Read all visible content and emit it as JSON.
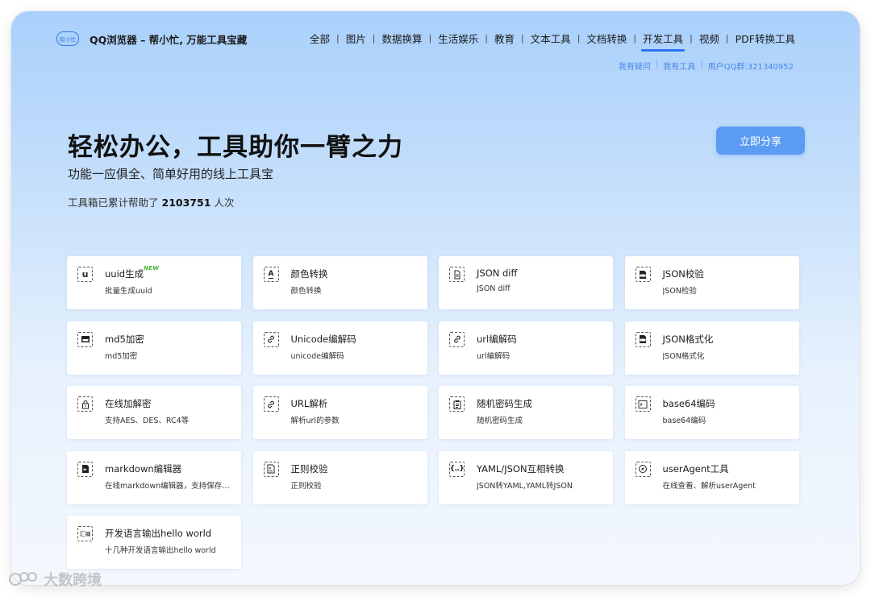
{
  "header": {
    "logo_text": "帮小忙",
    "site_title": "QQ浏览器 – 帮小忙, 万能工具宝藏",
    "nav": [
      {
        "label": "全部",
        "active": false
      },
      {
        "label": "图片",
        "active": false
      },
      {
        "label": "数据换算",
        "active": false
      },
      {
        "label": "生活娱乐",
        "active": false
      },
      {
        "label": "教育",
        "active": false
      },
      {
        "label": "文本工具",
        "active": false
      },
      {
        "label": "文档转换",
        "active": false
      },
      {
        "label": "开发工具",
        "active": true
      },
      {
        "label": "视频",
        "active": false
      },
      {
        "label": "PDF转换工具",
        "active": false
      }
    ],
    "subnav": {
      "question": "我有疑问",
      "my_tools": "我有工具",
      "qq_group": "用户QQ群:321340952"
    }
  },
  "hero": {
    "title": "轻松办公，工具助你一臂之力",
    "subtitle": "功能一应俱全、简单好用的线上工具宝",
    "count_prefix": "工具箱已累计帮助了",
    "count": "2103751",
    "count_suffix": "人次",
    "share_button": "立即分享"
  },
  "tools": [
    {
      "name": "uuid生成",
      "desc": "批量生成uuid",
      "icon": "u-letter-icon",
      "badge": "NEW"
    },
    {
      "name": "颜色转换",
      "desc": "颜色转换",
      "icon": "font-color-icon"
    },
    {
      "name": "JSON diff",
      "desc": "JSON diff",
      "icon": "document-icon"
    },
    {
      "name": "JSON校验",
      "desc": "JSON检验",
      "icon": "json-file-icon"
    },
    {
      "name": "md5加密",
      "desc": "md5加密",
      "icon": "md5-icon"
    },
    {
      "name": "Unicode编解码",
      "desc": "unicode编解码",
      "icon": "link-icon"
    },
    {
      "name": "url编解码",
      "desc": "url编解码",
      "icon": "link-icon"
    },
    {
      "name": "JSON格式化",
      "desc": "JSON格式化",
      "icon": "json-file-icon"
    },
    {
      "name": "在线加解密",
      "desc": "支持AES、DES、RC4等",
      "icon": "lock-icon"
    },
    {
      "name": "URL解析",
      "desc": "解析url的参数",
      "icon": "link-icon"
    },
    {
      "name": "随机密码生成",
      "desc": "随机密码生成",
      "icon": "clipboard-icon"
    },
    {
      "name": "base64编码",
      "desc": "base64编码",
      "icon": "terminal-icon"
    },
    {
      "name": "markdown编辑器",
      "desc": "在线markdown编辑器，支持保存…",
      "icon": "markdown-file-icon"
    },
    {
      "name": "正则校验",
      "desc": "正则校验",
      "icon": "regex-file-icon"
    },
    {
      "name": "YAML/JSON互相转换",
      "desc": "JSON转YAML,YAML转JSON",
      "icon": "curly-braces-icon"
    },
    {
      "name": "userAgent工具",
      "desc": "在线查看、解析userAgent",
      "icon": "compass-icon"
    },
    {
      "name": "开发语言输出hello world",
      "desc": "十几种开发语言输出hello world",
      "icon": "assembly-icon"
    }
  ],
  "watermark": "大数跨境"
}
